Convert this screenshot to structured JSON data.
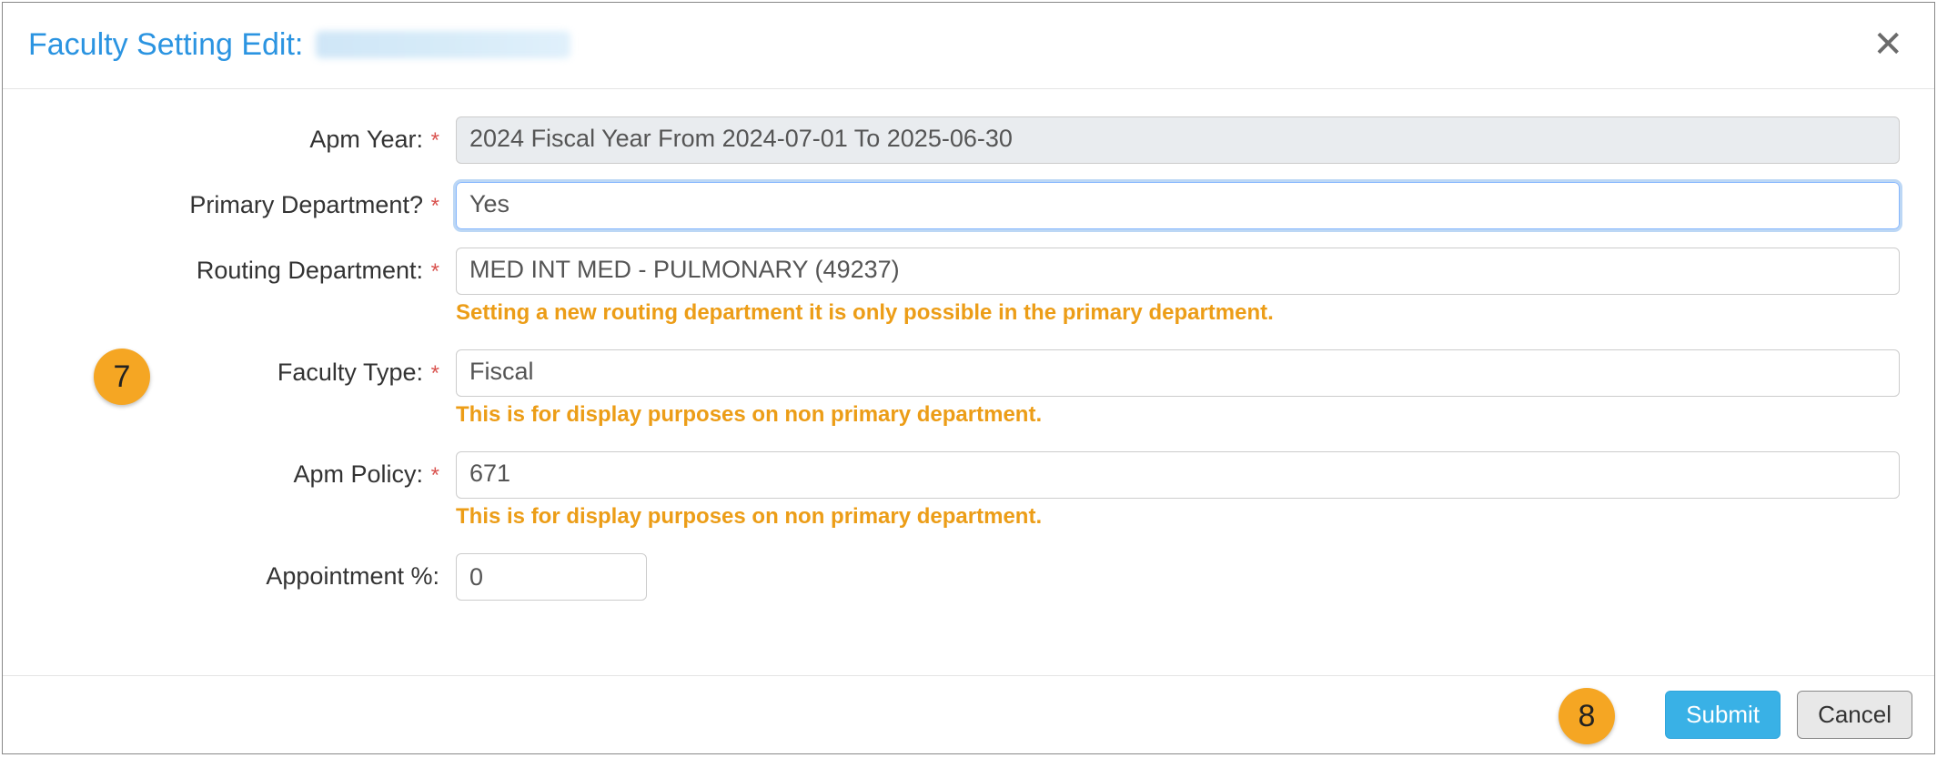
{
  "header": {
    "title_prefix": "Faculty Setting Edit:"
  },
  "form": {
    "apm_year": {
      "label": "Apm Year:",
      "value": "2024 Fiscal Year From 2024-07-01 To 2025-06-30"
    },
    "primary_department": {
      "label": "Primary Department?",
      "value": "Yes"
    },
    "routing_department": {
      "label": "Routing Department:",
      "value": "MED INT MED - PULMONARY (49237)",
      "help": "Setting a new routing department it is only possible in the primary department."
    },
    "faculty_type": {
      "label": "Faculty Type:",
      "value": "Fiscal",
      "help": "This is for display purposes on non primary department."
    },
    "apm_policy": {
      "label": "Apm Policy:",
      "value": "671",
      "help": "This is for display purposes on non primary department."
    },
    "appointment_pct": {
      "label": "Appointment %:",
      "value": "0"
    }
  },
  "footer": {
    "submit": "Submit",
    "cancel": "Cancel"
  },
  "annotations": {
    "seven": "7",
    "eight": "8"
  }
}
